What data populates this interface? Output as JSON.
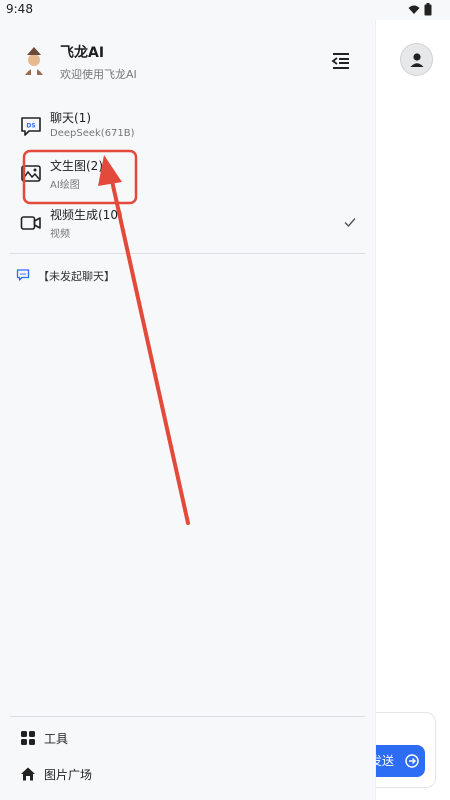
{
  "status_bar": {
    "time": "9:48"
  },
  "drawer": {
    "app_title": "飞龙AI",
    "app_subtitle": "欢迎使用飞龙AI",
    "modes": [
      {
        "title": "聊天(1)",
        "subtitle": "DeepSeek(671B)",
        "icon": "chat-ds-icon"
      },
      {
        "title": "文生图(2)",
        "subtitle": "AI绘图",
        "icon": "image-icon"
      },
      {
        "title": "视频生成(10)",
        "subtitle": "视频",
        "icon": "video-icon",
        "selected": true
      }
    ],
    "chat_history_label": "【未发起聊天】",
    "footer": [
      {
        "label": "工具",
        "icon": "grid-icon"
      },
      {
        "label": "图片广场",
        "icon": "home-icon"
      }
    ]
  },
  "background": {
    "send_label": "发送"
  },
  "colors": {
    "accent": "#2d6df6",
    "annotation": "#e34a3c",
    "drawer_bg": "#f7f8fa"
  }
}
